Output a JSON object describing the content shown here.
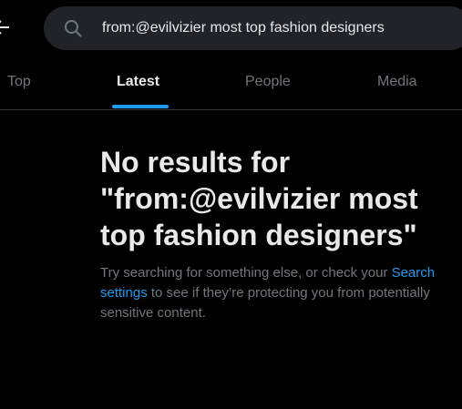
{
  "search": {
    "query": "from:@evilvizier most top fashion designers"
  },
  "tabs": [
    {
      "label": "Top",
      "active": false
    },
    {
      "label": "Latest",
      "active": true
    },
    {
      "label": "People",
      "active": false
    },
    {
      "label": "Media",
      "active": false
    }
  ],
  "empty_state": {
    "title": "No results for \"from:@evilvizier most top fashion designers\"",
    "desc_before": "Try searching for something else, or check your ",
    "desc_link": "Search settings",
    "desc_after": " to see if they’re protecting you from potentially sensitive content."
  },
  "colors": {
    "background": "#000000",
    "search_bg": "#202327",
    "text_primary": "#e7e9ea",
    "text_secondary": "#71767b",
    "accent": "#1d9bf0",
    "divider": "#2f3336"
  },
  "icons": {
    "back": "back-arrow-icon",
    "search": "search-icon"
  }
}
